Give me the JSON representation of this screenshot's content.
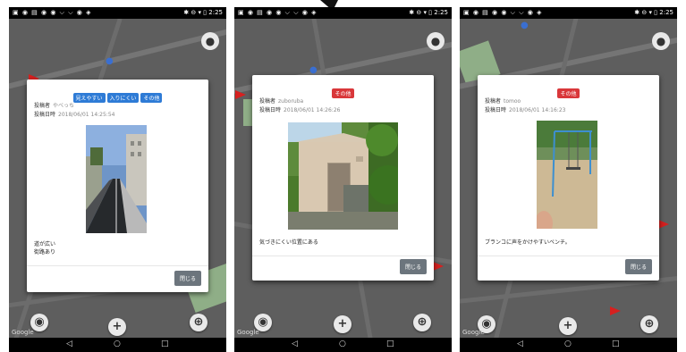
{
  "status_bar": {
    "time": "2:25"
  },
  "nav": {
    "back": "◁",
    "home": "○",
    "recent": "□"
  },
  "map": {
    "attribution": "Google"
  },
  "posts": [
    {
      "tags": [
        "見えやすい",
        "入りにくい",
        "その他"
      ],
      "tag_colors": [
        "#2e7bd6",
        "#2e7bd6",
        "#2e7bd6"
      ],
      "author_label": "投稿者",
      "author": "やべっち",
      "date_label": "投稿日時",
      "date": "2018/06/01 14:25:54",
      "comment": "道が広い\n街路あり",
      "close_label": "閉じる"
    },
    {
      "tags": [
        "その他"
      ],
      "tag_colors": [
        "#d9373a"
      ],
      "author_label": "投稿者",
      "author": "zuboruba",
      "date_label": "投稿日時",
      "date": "2018/06/01 14:26:26",
      "comment": "気づきにくい位置にある",
      "close_label": "閉じる"
    },
    {
      "tags": [
        "その他"
      ],
      "tag_colors": [
        "#d9373a"
      ],
      "author_label": "投稿者",
      "author": "tomoo",
      "date_label": "投稿日時",
      "date": "2018/06/01 14:16:23",
      "comment": "ブランコに声をかけやすいベンチ。",
      "close_label": "閉じる"
    }
  ]
}
